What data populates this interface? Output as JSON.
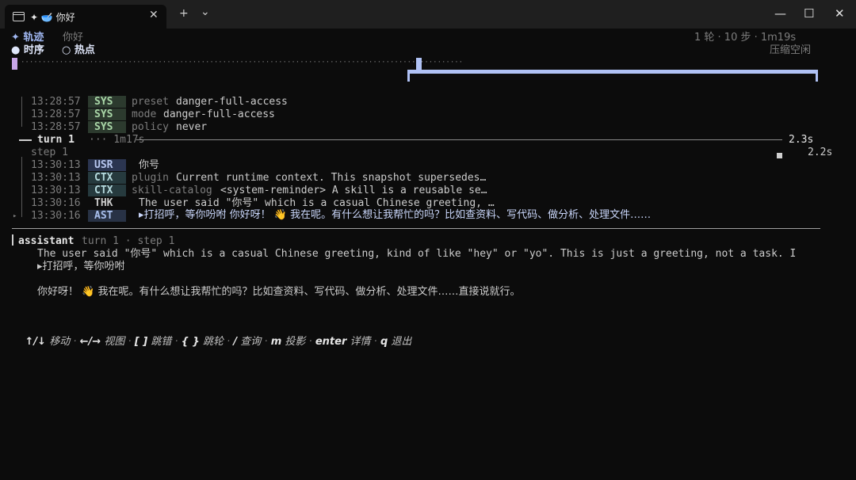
{
  "window": {
    "tab_title": "✦ 🥣 你好",
    "new_tab": "+",
    "dropdown": "⌄",
    "minimize": "—",
    "maximize": "☐",
    "close": "✕",
    "tab_close": "✕"
  },
  "header": {
    "title": "✦ 轨迹",
    "subtitle": "你好",
    "stats": "1 轮 · 10 步 · 1m19s",
    "view_timeline": "● 时序",
    "view_hotspot": "○ 热点",
    "mode": "压缩空闲"
  },
  "timeline": {
    "dots": "·······································································································"
  },
  "rows": {
    "sys": [
      {
        "time": "13:28:57",
        "tag": "SYS",
        "key": "preset",
        "val": "danger-full-access"
      },
      {
        "time": "13:28:57",
        "tag": "SYS",
        "key": "mode",
        "val": "danger-full-access"
      },
      {
        "time": "13:28:57",
        "tag": "SYS",
        "key": "policy",
        "val": "never"
      }
    ],
    "turn": {
      "label": "turn 1",
      "elapsed": "··· 1m17s",
      "duration": "2.3s",
      "step_label": "step 1",
      "step_duration": "2.2s"
    },
    "steps": [
      {
        "time": "13:30:13",
        "tag": "USR",
        "key": "",
        "val": "你号"
      },
      {
        "time": "13:30:13",
        "tag": "CTX",
        "key": "plugin",
        "val": "Current runtime context. This snapshot supersedes…"
      },
      {
        "time": "13:30:13",
        "tag": "CTX",
        "key": "skill-catalog",
        "val": "<system-reminder> A skill is a reusable se…"
      },
      {
        "time": "13:30:16",
        "tag": "THK",
        "key": "",
        "val": "The user said \"你号\" which is a casual Chinese greeting, …"
      },
      {
        "time": "13:30:16",
        "tag": "AST",
        "key": "",
        "val": "▸打招呼，等你吩咐 你好呀！ 👋 我在呢。有什么想让我帮忙的吗？比如查资料、写代码、做分析、处理文件……"
      }
    ]
  },
  "detail": {
    "role": "assistant",
    "meta": "turn 1 · step 1",
    "thinking": "The user said \"你号\" which is a casual Chinese greeting, kind of like \"hey\" or \"yo\". This is just a greeting, not a task. I",
    "summary": "▸打招呼，等你吩咐",
    "reply": "你好呀！ 👋 我在呢。有什么想让我帮忙的吗？比如查资料、写代码、做分析、处理文件……直接说就行。"
  },
  "footer": {
    "keys": [
      {
        "key": "↑/↓",
        "label": "移动"
      },
      {
        "key": "←/→",
        "label": "视图"
      },
      {
        "key": "[ ]",
        "label": "跳错"
      },
      {
        "key": "{ }",
        "label": "跳轮"
      },
      {
        "key": "/",
        "label": "查询"
      },
      {
        "key": "m",
        "label": "投影"
      },
      {
        "key": "enter",
        "label": "详情"
      },
      {
        "key": "q",
        "label": "退出"
      }
    ]
  },
  "colors": {
    "accent": "#9fb6f0",
    "bg": "#0c0c0c",
    "highlight": "#b0c2f5",
    "marker": "#c8a6e8"
  }
}
